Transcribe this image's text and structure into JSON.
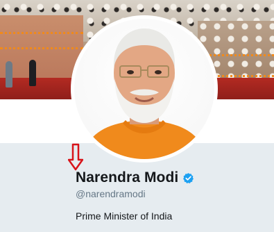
{
  "profile": {
    "name": "Narendra Modi",
    "handle": "@narendramodi",
    "bio": "Prime Minister of India",
    "verified": true
  },
  "icons": {
    "verified": "verified-badge-icon",
    "annotation": "red-down-arrow-icon"
  },
  "colors": {
    "verified_blue": "#1da1f2",
    "annotation_red": "#d8141a",
    "page_background": "#e6ecf0",
    "name_text": "#14171a",
    "handle_text": "#657786"
  }
}
